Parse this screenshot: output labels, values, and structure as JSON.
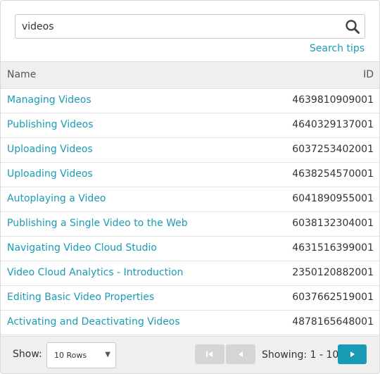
{
  "search": {
    "value": "videos",
    "tips_label": "Search tips"
  },
  "table": {
    "columns": {
      "name": "Name",
      "id": "ID"
    },
    "rows": [
      {
        "name": "Managing Videos",
        "id": "4639810909001"
      },
      {
        "name": "Publishing Videos",
        "id": "4640329137001"
      },
      {
        "name": "Uploading Videos",
        "id": "6037253402001"
      },
      {
        "name": "Uploading Videos",
        "id": "4638254570001"
      },
      {
        "name": "Autoplaying a Video",
        "id": "6041890955001"
      },
      {
        "name": "Publishing a Single Video to the Web",
        "id": "6038132304001"
      },
      {
        "name": "Navigating Video Cloud Studio",
        "id": "4631516399001"
      },
      {
        "name": "Video Cloud Analytics - Introduction",
        "id": "2350120882001"
      },
      {
        "name": "Editing Basic Video Properties",
        "id": "6037662519001"
      },
      {
        "name": "Activating and Deactivating Videos",
        "id": "4878165648001"
      }
    ]
  },
  "footer": {
    "show_label": "Show:",
    "rows_per_page": "10 Rows",
    "showing_text": "Showing: 1 - 10"
  },
  "icons": {
    "search": "search-icon",
    "first_page": "first-page-icon",
    "prev_page": "prev-page-icon",
    "next_page": "next-page-icon",
    "dropdown": "chevron-down-icon"
  },
  "colors": {
    "accent": "#1a9bb5",
    "header_bg": "#efefef",
    "disabled_button": "#d5d5d5"
  }
}
